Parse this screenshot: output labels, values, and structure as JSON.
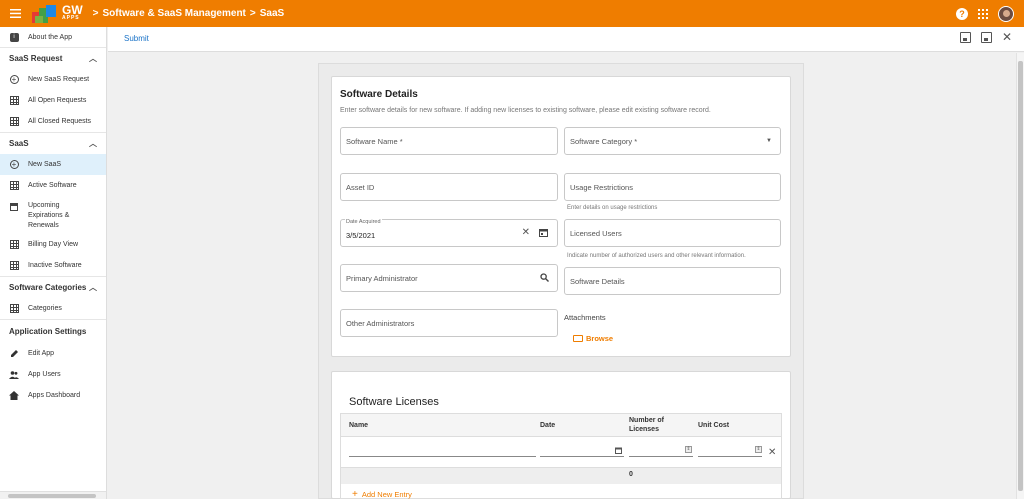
{
  "header": {
    "logo_text": "GW",
    "logo_sub": "APPS",
    "breadcrumb": [
      "Software & SaaS Management",
      "SaaS"
    ]
  },
  "sidebar": {
    "about": "About the App",
    "sections": [
      {
        "title": "SaaS Request",
        "items": [
          "New SaaS Request",
          "All Open Requests",
          "All Closed Requests"
        ]
      },
      {
        "title": "SaaS",
        "items": [
          "New SaaS",
          "Active Software",
          "Upcoming Expirations & Renewals",
          "Billing Day View",
          "Inactive Software"
        ]
      },
      {
        "title": "Software Categories",
        "items": [
          "Categories"
        ]
      }
    ],
    "app_settings": {
      "title": "Application Settings",
      "items": [
        "Edit App",
        "App Users",
        "Apps Dashboard"
      ]
    }
  },
  "toolbar": {
    "submit": "Submit"
  },
  "form": {
    "title": "Software Details",
    "subtitle": "Enter software details for new software. If adding new licenses to existing software, please edit existing software record.",
    "software_name": "Software Name *",
    "software_category": "Software Category *",
    "asset_id": "Asset ID",
    "usage_restrictions": "Usage Restrictions",
    "usage_hint": "Enter details on usage restrictions",
    "date_label": "Date Acquired",
    "date_value": "3/5/2021",
    "licensed_users": "Licensed Users",
    "licensed_hint": "Indicate number of authorized users and other relevant information.",
    "primary_admin": "Primary Administrator",
    "software_details": "Software Details",
    "other_admins": "Other Administrators",
    "attachments": "Attachments",
    "browse": "Browse"
  },
  "licenses": {
    "title": "Software Licenses",
    "columns": [
      "Name",
      "Date",
      "Number of Licenses",
      "Unit Cost"
    ],
    "total": "0",
    "add": "Add New Entry"
  }
}
